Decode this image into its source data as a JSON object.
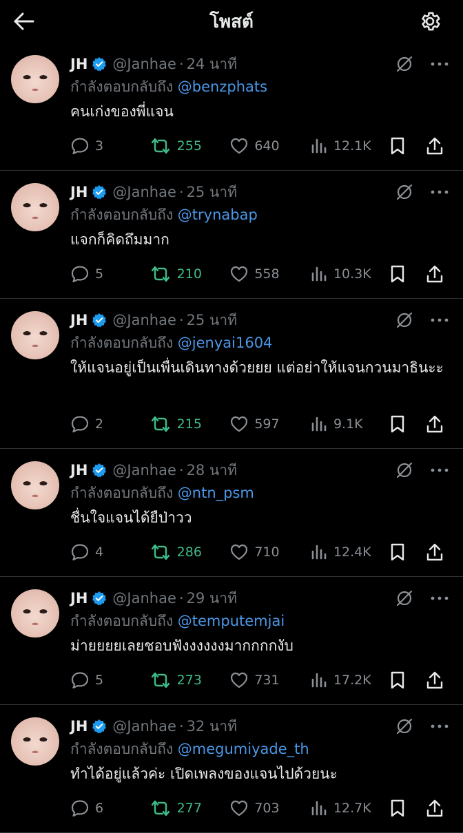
{
  "header": {
    "title": "โพสต์"
  },
  "colors": {
    "background": "#000000",
    "mention": "#4a97e7",
    "verified": "#1d9bf0",
    "retweet": "#3fbc87",
    "muted": "#71767b"
  },
  "icons": [
    "back-arrow-icon",
    "settings-gear-icon",
    "verified-badge-icon",
    "grok-icon",
    "more-icon",
    "reply-icon",
    "retweet-icon",
    "like-icon",
    "views-icon",
    "bookmark-icon",
    "share-icon"
  ],
  "posts": [
    {
      "name": "JH",
      "handle": "@Janhae",
      "dot": "·",
      "time": "24 นาที",
      "replying": "กำลังตอบกลับถึง",
      "mention": "@benzphats",
      "text": "คนเก่งของพี่แจน",
      "replies": "3",
      "retweets": "255",
      "likes": "640",
      "views": "12.1K"
    },
    {
      "name": "JH",
      "handle": "@Janhae",
      "dot": "·",
      "time": "25 นาที",
      "replying": "กำลังตอบกลับถึง",
      "mention": "@trynabap",
      "text": "แจกก็คิดถึมมาก",
      "replies": "5",
      "retweets": "210",
      "likes": "558",
      "views": "10.3K"
    },
    {
      "name": "JH",
      "handle": "@Janhae",
      "dot": "·",
      "time": "25 นาที",
      "replying": "กำลังตอบกลับถึง",
      "mention": "@jenyai1604",
      "text": "ให้แจนอยู่เป็นเพื่นเดินทางด้วยยย แต่อย่าให้แจนกวนมาธินะะ",
      "replies": "2",
      "retweets": "215",
      "likes": "597",
      "views": "9.1K"
    },
    {
      "name": "JH",
      "handle": "@Janhae",
      "dot": "·",
      "time": "28 นาที",
      "replying": "กำลังตอบกลับถึง",
      "mention": "@ntn_psm",
      "text": "ชื่นใจแจนได้ยืป่าวว",
      "replies": "4",
      "retweets": "286",
      "likes": "710",
      "views": "12.4K"
    },
    {
      "name": "JH",
      "handle": "@Janhae",
      "dot": "·",
      "time": "29 นาที",
      "replying": "กำลังตอบกลับถึง",
      "mention": "@temputemjai",
      "text": "ม่ายยยยเลยชอบฟังงงงงงมากกกกงับ",
      "replies": "5",
      "retweets": "273",
      "likes": "731",
      "views": "17.2K"
    },
    {
      "name": "JH",
      "handle": "@Janhae",
      "dot": "·",
      "time": "32 นาที",
      "replying": "กำลังตอบกลับถึง",
      "mention": "@megumiyade_th",
      "text": "ทำได้อยู่แล้วค่ะ เปิดเพลงของแจนไปด้วยนะ",
      "replies": "6",
      "retweets": "277",
      "likes": "703",
      "views": "12.7K"
    }
  ]
}
